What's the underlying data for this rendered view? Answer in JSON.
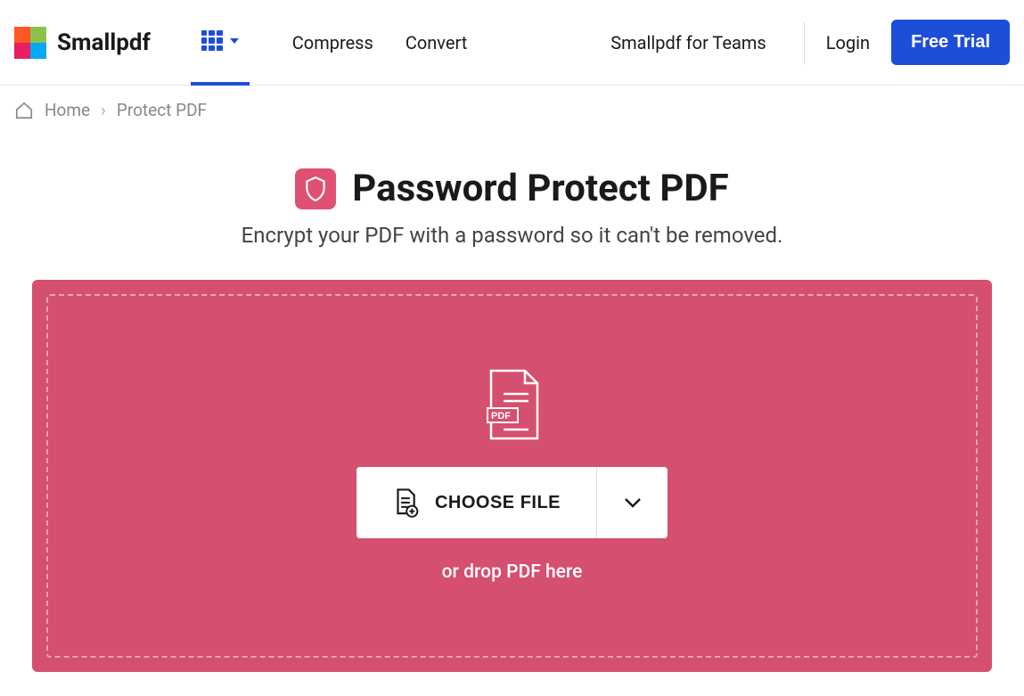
{
  "header": {
    "brand": "Smallpdf",
    "nav": {
      "compress": "Compress",
      "convert": "Convert",
      "teams": "Smallpdf for Teams"
    },
    "login": "Login",
    "free_trial": "Free Trial"
  },
  "breadcrumb": {
    "home": "Home",
    "separator": "›",
    "current": "Protect PDF"
  },
  "hero": {
    "title": "Password Protect PDF",
    "subtitle": "Encrypt your PDF with a password so it can't be removed."
  },
  "upload": {
    "choose_file": "CHOOSE FILE",
    "drop_text": "or drop PDF here"
  },
  "colors": {
    "primary_blue": "#1d4ed8",
    "accent_pink": "#d54f6f",
    "badge_pink": "#e05072"
  }
}
